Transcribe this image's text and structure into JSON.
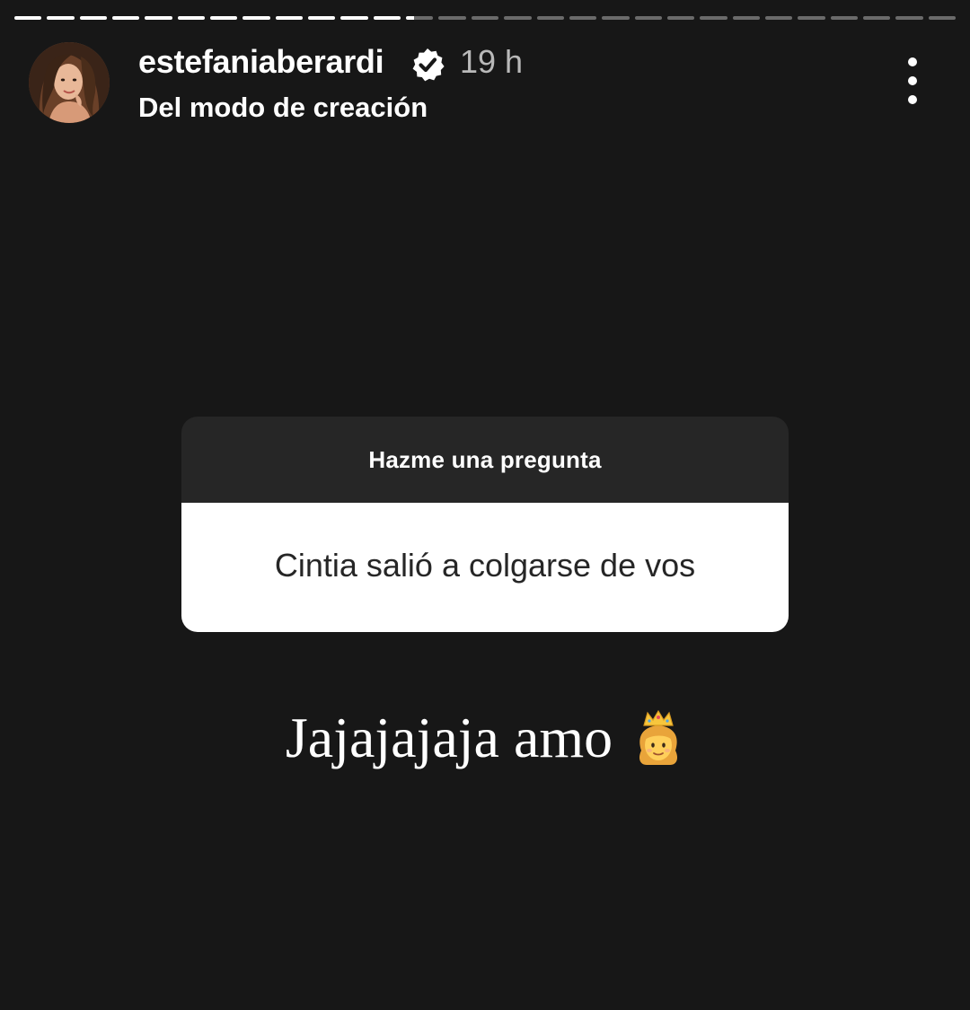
{
  "story": {
    "progress_segments_total": 29,
    "progress_segments_completed": 12
  },
  "header": {
    "username": "estefaniaberardi",
    "verified": true,
    "verified_icon": "verified-badge-icon",
    "time": "19 h",
    "subtitle": "Del modo de creación",
    "more_icon": "more-vertical-icon"
  },
  "question_sticker": {
    "title": "Hazme una pregunta",
    "question": "Cintia salió a colgarse de vos"
  },
  "reply": {
    "text": "Jajajajaja amo",
    "emoji_icon": "princess-emoji-icon"
  },
  "colors": {
    "background": "#171717",
    "card_header": "#262626",
    "card_body": "#ffffff",
    "progress_done": "#ffffff",
    "progress_pending": "#6b6b6b"
  }
}
